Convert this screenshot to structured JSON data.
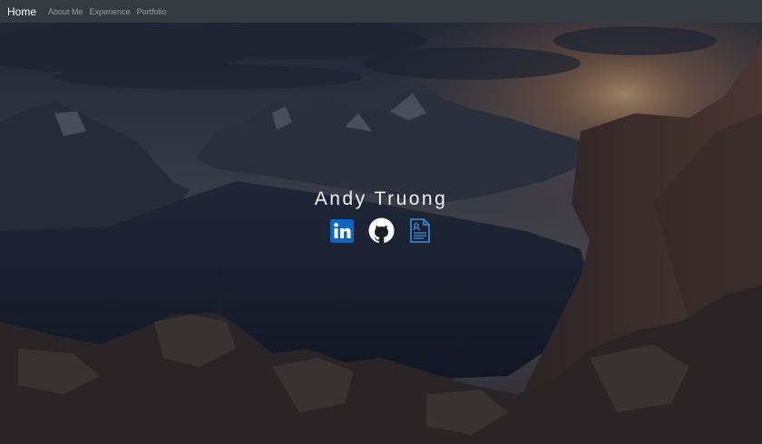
{
  "navbar": {
    "brand": "Home",
    "links": [
      "About Me",
      "Experience",
      "Portfolio"
    ]
  },
  "hero": {
    "name": "Andy Truong",
    "social_icons": [
      "linkedin-icon",
      "github-icon",
      "resume-icon"
    ]
  },
  "colors": {
    "navbar_bg": "#343a40",
    "nav_link": "#9aa0a6",
    "linkedin_blue": "#0a66c2",
    "resume_blue": "#3b8edb",
    "name_text": "#f2f2f2"
  }
}
